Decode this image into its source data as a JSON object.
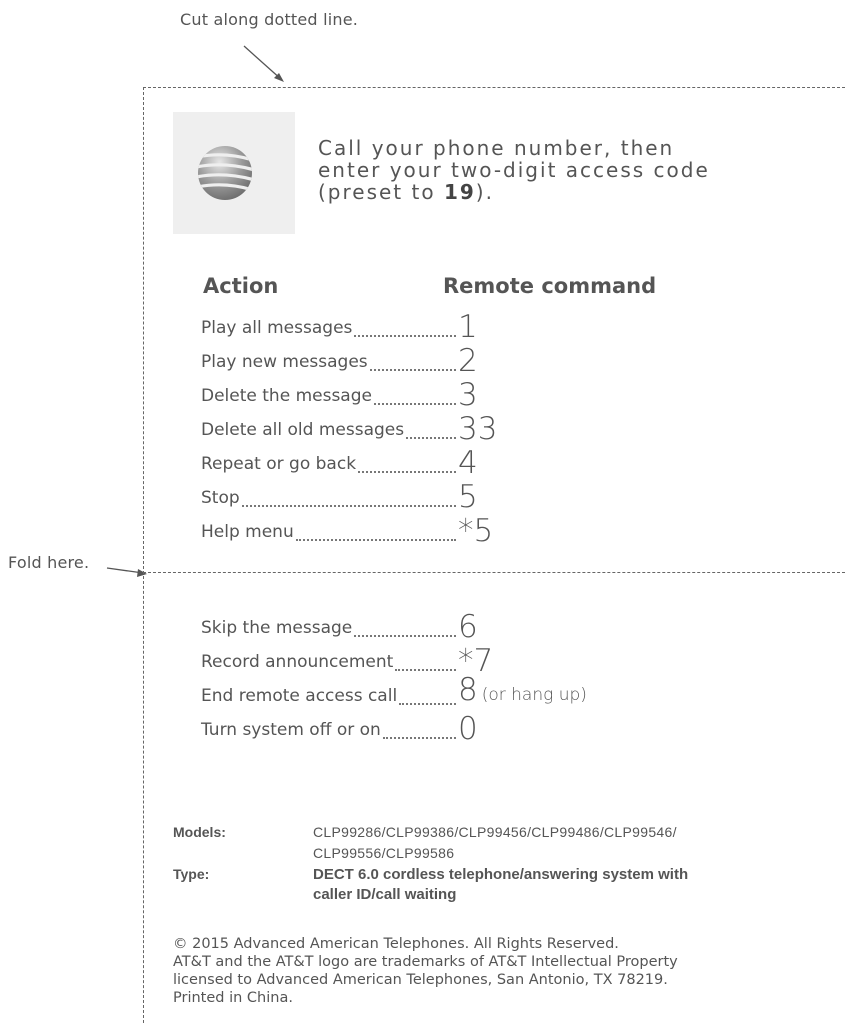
{
  "notes": {
    "cut": "Cut along dotted line.",
    "fold": "Fold here."
  },
  "logo": {
    "icon": "att-globe-icon"
  },
  "intro": {
    "line1": "Call your phone number, then",
    "line2": "enter your two-digit access code",
    "line3_pre": "(preset to ",
    "line3_code": "19",
    "line3_post": ")."
  },
  "table": {
    "col_action": "Action",
    "col_command": "Remote command"
  },
  "commands_top": [
    {
      "label": "Play all messages",
      "cmd": "1"
    },
    {
      "label": "Play new messages",
      "cmd": "2"
    },
    {
      "label": "Delete the message",
      "cmd": "3"
    },
    {
      "label": "Delete all old messages",
      "cmd": "33"
    },
    {
      "label": "Repeat or go back",
      "cmd": "4"
    },
    {
      "label": "Stop",
      "cmd": "5"
    },
    {
      "label": "Help menu",
      "cmd": "*5"
    }
  ],
  "commands_bottom": [
    {
      "label": "Skip the message",
      "cmd": "6",
      "after": ""
    },
    {
      "label": "Record announcement",
      "cmd": "*7",
      "after": ""
    },
    {
      "label": "End remote access call",
      "cmd": "8",
      "after": "(or hang up)"
    },
    {
      "label": "Turn system off or on",
      "cmd": "0",
      "after": ""
    }
  ],
  "meta": {
    "models_label": "Models:",
    "models_line1": "CLP99286/CLP99386/CLP99456/CLP99486/CLP99546/",
    "models_line2": "CLP99556/CLP99586",
    "type_label": "Type:",
    "type_line1": "DECT 6.0 cordless telephone/answering system with",
    "type_line2": "caller ID/call waiting"
  },
  "legal": {
    "line1": "© 2015 Advanced American Telephones. All Rights Reserved.",
    "line2": "AT&T and the AT&T logo are trademarks of AT&T Intellectual Property",
    "line3": "licensed to Advanced American Telephones, San Antonio, TX 78219.",
    "line4": "Printed in China."
  }
}
